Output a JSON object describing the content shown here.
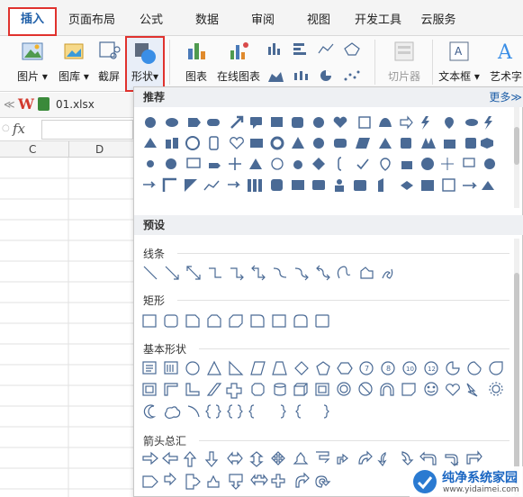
{
  "tabs": {
    "insert": "插入",
    "page_layout": "页面布局",
    "formula": "公式",
    "data": "数据",
    "review": "审阅",
    "view": "视图",
    "dev_tools": "开发工具",
    "cloud": "云服务"
  },
  "ribbon": {
    "picture": "图片",
    "gallery": "图库",
    "screenshot": "截屏",
    "shapes": "形状",
    "chart": "图表",
    "online_chart": "在线图表",
    "slicer": "切片器",
    "textbox": "文本框",
    "wordart": "艺术字"
  },
  "file_tab": {
    "name": "01.xlsx"
  },
  "formula_bar": {
    "fx": "fx"
  },
  "sheet": {
    "columns": [
      "C",
      "D"
    ]
  },
  "panel": {
    "recommended": "推荐",
    "more": "更多≫",
    "preset": "预设",
    "categories": {
      "lines": "线条",
      "rectangles": "矩形",
      "basic_shapes": "基本形状",
      "block_arrows": "箭头总汇"
    }
  },
  "watermark": {
    "title": "纯净系统家园",
    "url": "www.yidaimei.com"
  },
  "colors": {
    "accent_red": "#e0322e",
    "icon_blue": "#4a6a95",
    "link_blue": "#1f5fa8"
  }
}
